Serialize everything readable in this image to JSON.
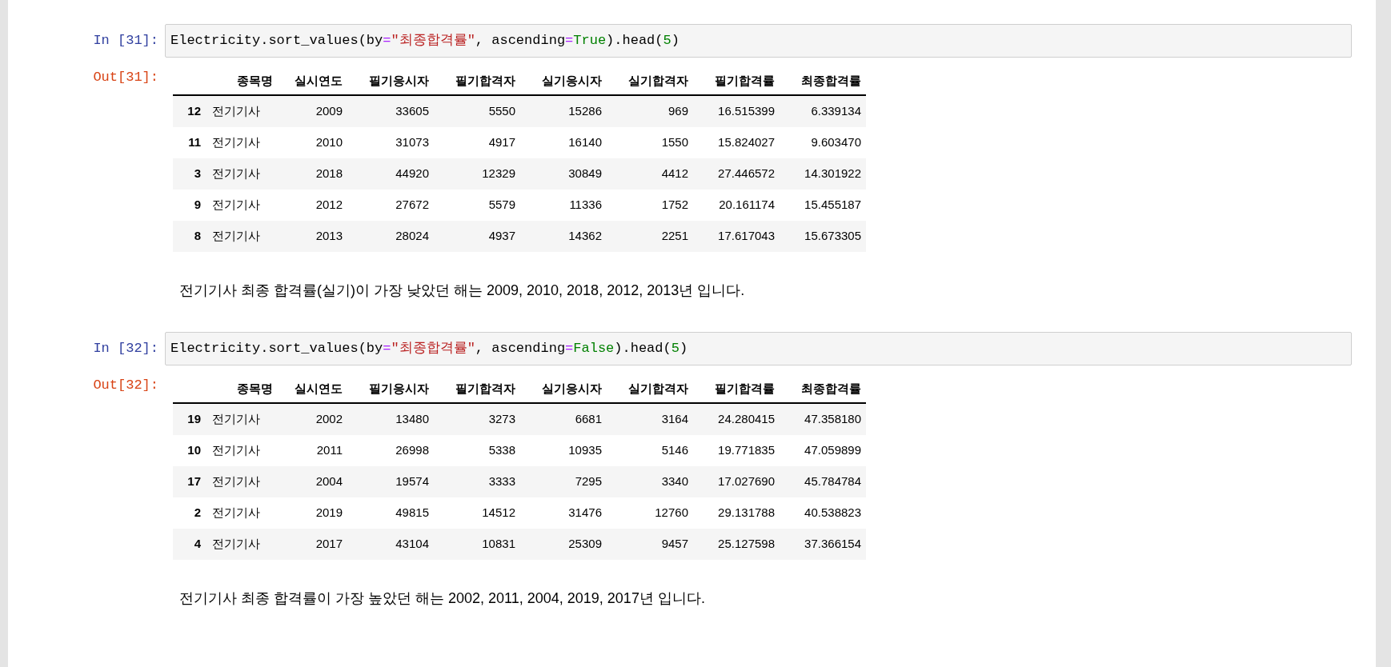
{
  "cells": [
    {
      "kind": "code",
      "in_prompt": "In [31]:",
      "code": [
        {
          "kind": "plain",
          "text": "Electricity.sort_values(by"
        },
        {
          "kind": "operator",
          "text": "="
        },
        {
          "kind": "string",
          "text": "\"최종합격률\""
        },
        {
          "kind": "plain",
          "text": ", ascending"
        },
        {
          "kind": "operator",
          "text": "="
        },
        {
          "kind": "keyword",
          "text": "True"
        },
        {
          "kind": "plain",
          "text": ").head("
        },
        {
          "kind": "number",
          "text": "5"
        },
        {
          "kind": "plain",
          "text": ")"
        }
      ],
      "out_prompt": "Out[31]:",
      "table": {
        "columns": [
          "종목명",
          "실시연도",
          "필기응시자",
          "필기합격자",
          "실기응시자",
          "실기합격자",
          "필기합격률",
          "최종합격률"
        ],
        "rows": [
          {
            "index": "12",
            "cells": [
              "전기기사",
              "2009",
              "33605",
              "5550",
              "15286",
              "969",
              "16.515399",
              "6.339134"
            ]
          },
          {
            "index": "11",
            "cells": [
              "전기기사",
              "2010",
              "31073",
              "4917",
              "16140",
              "1550",
              "15.824027",
              "9.603470"
            ]
          },
          {
            "index": "3",
            "cells": [
              "전기기사",
              "2018",
              "44920",
              "12329",
              "30849",
              "4412",
              "27.446572",
              "14.301922"
            ]
          },
          {
            "index": "9",
            "cells": [
              "전기기사",
              "2012",
              "27672",
              "5579",
              "11336",
              "1752",
              "20.161174",
              "15.455187"
            ]
          },
          {
            "index": "8",
            "cells": [
              "전기기사",
              "2013",
              "28024",
              "4937",
              "14362",
              "2251",
              "17.617043",
              "15.673305"
            ]
          }
        ]
      }
    },
    {
      "kind": "markdown",
      "text": "전기기사 최종 합격률(실기)이 가장 낮았던 해는 2009, 2010, 2018, 2012, 2013년 입니다."
    },
    {
      "kind": "code",
      "in_prompt": "In [32]:",
      "code": [
        {
          "kind": "plain",
          "text": "Electricity.sort_values(by"
        },
        {
          "kind": "operator",
          "text": "="
        },
        {
          "kind": "string",
          "text": "\"최종합격률\""
        },
        {
          "kind": "plain",
          "text": ", ascending"
        },
        {
          "kind": "operator",
          "text": "="
        },
        {
          "kind": "keyword",
          "text": "False"
        },
        {
          "kind": "plain",
          "text": ").head("
        },
        {
          "kind": "number",
          "text": "5"
        },
        {
          "kind": "plain",
          "text": ")"
        }
      ],
      "out_prompt": "Out[32]:",
      "table": {
        "columns": [
          "종목명",
          "실시연도",
          "필기응시자",
          "필기합격자",
          "실기응시자",
          "실기합격자",
          "필기합격률",
          "최종합격률"
        ],
        "rows": [
          {
            "index": "19",
            "cells": [
              "전기기사",
              "2002",
              "13480",
              "3273",
              "6681",
              "3164",
              "24.280415",
              "47.358180"
            ]
          },
          {
            "index": "10",
            "cells": [
              "전기기사",
              "2011",
              "26998",
              "5338",
              "10935",
              "5146",
              "19.771835",
              "47.059899"
            ]
          },
          {
            "index": "17",
            "cells": [
              "전기기사",
              "2004",
              "19574",
              "3333",
              "7295",
              "3340",
              "17.027690",
              "45.784784"
            ]
          },
          {
            "index": "2",
            "cells": [
              "전기기사",
              "2019",
              "49815",
              "14512",
              "31476",
              "12760",
              "29.131788",
              "40.538823"
            ]
          },
          {
            "index": "4",
            "cells": [
              "전기기사",
              "2017",
              "43104",
              "10831",
              "25309",
              "9457",
              "25.127598",
              "37.366154"
            ]
          }
        ]
      }
    },
    {
      "kind": "markdown",
      "text": "전기기사 최종 합격률이 가장 높았던 해는 2002, 2011, 2004, 2019, 2017년 입니다."
    }
  ]
}
